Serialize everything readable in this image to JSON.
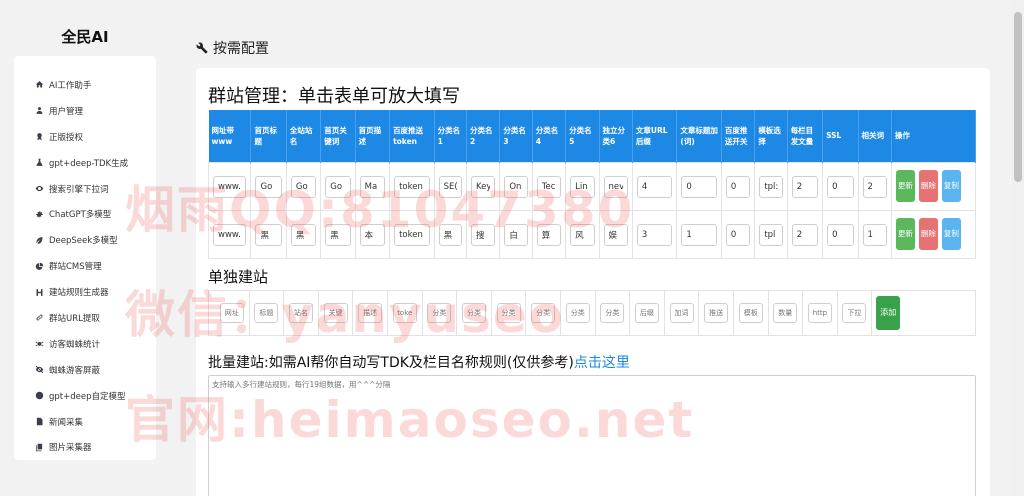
{
  "brand": "全民AI",
  "sidebar": {
    "items": [
      {
        "label": "AI工作助手",
        "icon": "home-icon"
      },
      {
        "label": "用户管理",
        "icon": "user-icon"
      },
      {
        "label": "正版授权",
        "icon": "badge-icon"
      },
      {
        "label": "gpt+deep-TDK生成",
        "icon": "flask-icon"
      },
      {
        "label": "搜索引擎下拉词",
        "icon": "eye-icon"
      },
      {
        "label": "ChatGPT多模型",
        "icon": "gear-icon"
      },
      {
        "label": "DeepSeek多模型",
        "icon": "leaf-icon"
      },
      {
        "label": "群站CMS管理",
        "icon": "pie-icon"
      },
      {
        "label": "建站规则生成器",
        "icon": "heading-icon"
      },
      {
        "label": "群站URL提取",
        "icon": "link-icon"
      },
      {
        "label": "访客蜘蛛统计",
        "icon": "spider-icon"
      },
      {
        "label": "蜘蛛游客屏蔽",
        "icon": "eye-slash-icon"
      },
      {
        "label": "gpt+deep自定模型",
        "icon": "globe-icon"
      },
      {
        "label": "新闻采集",
        "icon": "file-icon"
      },
      {
        "label": "图片采集器",
        "icon": "copy-icon"
      }
    ]
  },
  "page_title": "按需配置",
  "group": {
    "title": "群站管理：单击表单可放大填写",
    "headers": [
      "网址带www",
      "首页标题",
      "全站站名",
      "首页关键词",
      "首页描述",
      "百度推送token",
      "分类名1",
      "分类名2",
      "分类名3",
      "分类名4",
      "分类名5",
      "独立分类6",
      "文章URL后缀",
      "文章标题加(词)",
      "百度推送开关",
      "模板选择",
      "每栏目发文量",
      "SSL",
      "相关词",
      "操作"
    ],
    "rows": [
      [
        "www.",
        "Go",
        "Go",
        "Go",
        "Ma",
        "token",
        "SE(",
        "Key",
        "On",
        "Tec",
        "Lin",
        "nev",
        "4",
        "0",
        "0",
        "tpl:",
        "2",
        "0",
        "2"
      ],
      [
        "www.",
        "黑",
        "黑",
        "黑",
        "本",
        "token",
        "黑",
        "搜",
        "白",
        "算",
        "风",
        "娱",
        "3",
        "1",
        "0",
        "tpl",
        "2",
        "0",
        "1"
      ]
    ],
    "buttons": {
      "update": "更新",
      "delete": "删除",
      "copy": "复制"
    }
  },
  "single": {
    "title": "单独建站",
    "placeholders": [
      "网址",
      "标题",
      "站名",
      "关键",
      "描述",
      "toke",
      "分类",
      "分类",
      "分类",
      "分类",
      "分类",
      "分类",
      "后缀",
      "加词",
      "推送",
      "模板",
      "数量",
      "http",
      "下拉"
    ],
    "add_label": "添加"
  },
  "batch": {
    "title": "批量建站:如需AI帮你自动写TDK及栏目名称规则(仅供参考)",
    "link": "点击这里",
    "placeholder": "支持输入多行建站规则，每行19组数据，用^^^分隔"
  },
  "watermark": {
    "line1": "烟雨QQ:81047380",
    "line2": "微信：yanyuseo",
    "line3": "官网:heimaoseo.net"
  }
}
